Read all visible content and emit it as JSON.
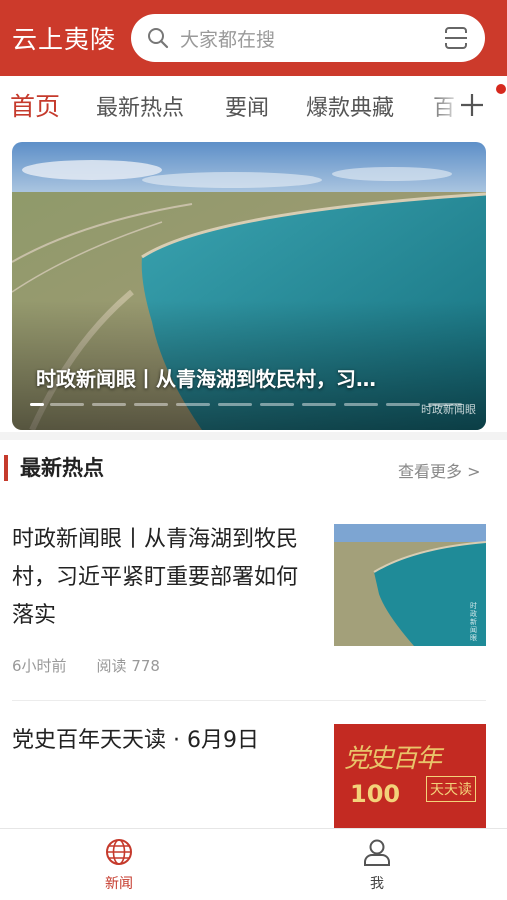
{
  "header": {
    "app_title": "云上夷陵",
    "search_placeholder": "大家都在搜"
  },
  "tabs": [
    {
      "label": "首页",
      "active": true
    },
    {
      "label": "最新热点"
    },
    {
      "label": "要闻"
    },
    {
      "label": "爆款典藏"
    },
    {
      "label": "百"
    }
  ],
  "banner": {
    "caption": "时政新闻眼丨从青海湖到牧民村，习…",
    "watermark": "时政新闻眼",
    "slide_count": 11,
    "active_slide": 1
  },
  "section": {
    "title": "最新热点",
    "more_label": "查看更多 >"
  },
  "articles": [
    {
      "title": "时政新闻眼丨从青海湖到牧民村，习近平紧盯重要部署如何落实",
      "time": "6小时前",
      "reads": "阅读  778",
      "thumb_watermark": "时政新闻眼"
    },
    {
      "title": "党史百年天天读  ·  6月9日",
      "thumb_text": "党史百年",
      "thumb_number": "100",
      "thumb_badge": "天天读"
    }
  ],
  "bottom_nav": [
    {
      "label": "新闻",
      "active": true,
      "icon": "globe-icon"
    },
    {
      "label": "我",
      "active": false,
      "icon": "user-icon"
    }
  ],
  "colors": {
    "brand_red": "#cc3a2b",
    "tab_active": "#c53a2c",
    "text_gray": "#999999"
  }
}
